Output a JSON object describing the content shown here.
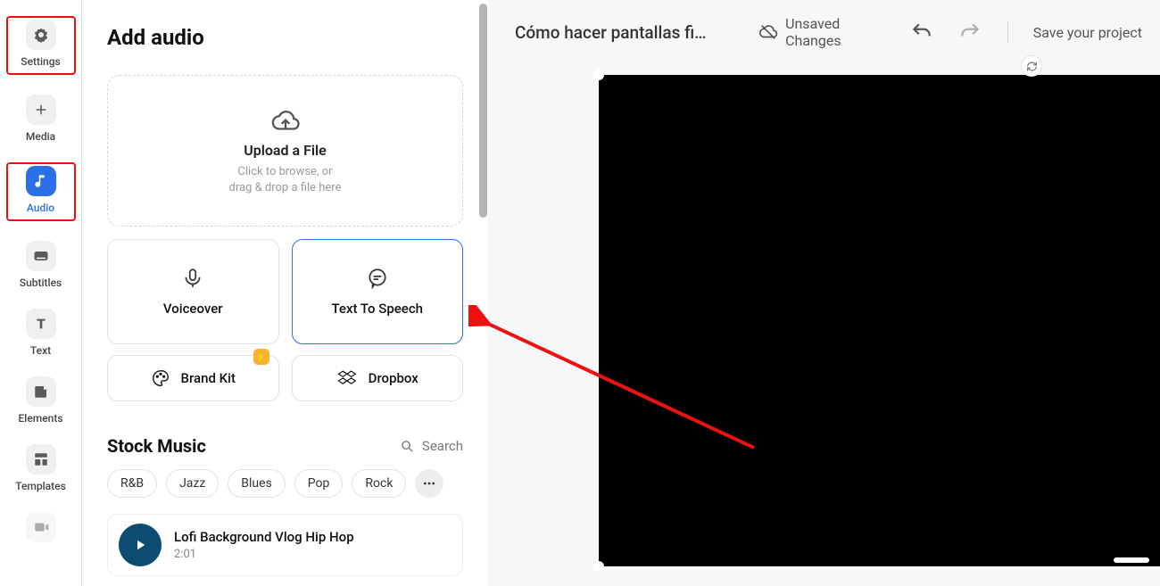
{
  "sidebar": {
    "items": [
      {
        "label": "Settings",
        "icon": "gear"
      },
      {
        "label": "Media",
        "icon": "plus"
      },
      {
        "label": "Audio",
        "icon": "note",
        "active": true
      },
      {
        "label": "Subtitles",
        "icon": "subtitle"
      },
      {
        "label": "Text",
        "icon": "text"
      },
      {
        "label": "Elements",
        "icon": "sticker"
      },
      {
        "label": "Templates",
        "icon": "templates"
      }
    ]
  },
  "panel": {
    "title": "Add audio",
    "upload": {
      "title": "Upload a File",
      "subtitle": "Click to browse, or\ndrag & drop a file here"
    },
    "option_voiceover": "Voiceover",
    "option_tts": "Text To Speech",
    "brand_kit": "Brand Kit",
    "dropbox": "Dropbox",
    "stock": {
      "title": "Stock Music",
      "search": "Search",
      "genres": [
        "R&B",
        "Jazz",
        "Blues",
        "Pop",
        "Rock"
      ],
      "track": {
        "title": "Lofi Background Vlog Hip Hop",
        "duration": "2:01"
      }
    }
  },
  "topbar": {
    "project_title": "Cómo hacer pantallas final...",
    "unsaved": "Unsaved Changes",
    "save": "Save your project"
  },
  "colors": {
    "accent": "#2a6fe8",
    "annotation": "#e11"
  }
}
